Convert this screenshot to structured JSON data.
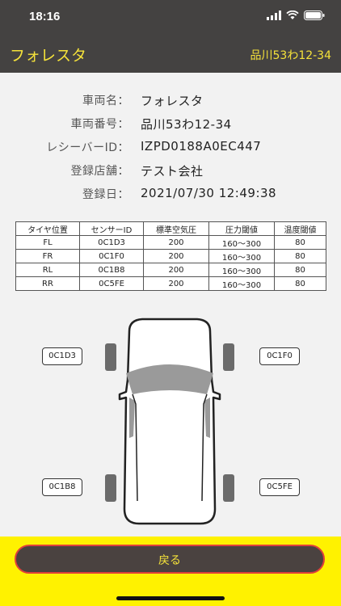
{
  "status": {
    "time": "18:16"
  },
  "header": {
    "title": "フォレスタ",
    "plate": "品川53わ12-34"
  },
  "info": [
    {
      "label": "車両名：",
      "value": "フォレスタ"
    },
    {
      "label": "車両番号：",
      "value": "品川53わ12-34"
    },
    {
      "label": "レシーバーID：",
      "value": "IZPD0188A0EC447"
    },
    {
      "label": "登録店舗：",
      "value": "テスト会社"
    },
    {
      "label": "登録日：",
      "value": "2021/07/30 12:49:38"
    }
  ],
  "table": {
    "headers": [
      "タイヤ位置",
      "センサーID",
      "標準空気圧",
      "圧力閾値",
      "温度閾値"
    ],
    "rows": [
      [
        "FL",
        "0C1D3",
        "200",
        "160～300",
        "80"
      ],
      [
        "FR",
        "0C1F0",
        "200",
        "160～300",
        "80"
      ],
      [
        "RL",
        "0C1B8",
        "200",
        "160～300",
        "80"
      ],
      [
        "RR",
        "0C5FE",
        "200",
        "160～300",
        "80"
      ]
    ]
  },
  "sensors": {
    "fl": "0C1D3",
    "fr": "0C1F0",
    "rl": "0C1B8",
    "rr": "0C5FE"
  },
  "footer": {
    "back_label": "戻る"
  },
  "colors": {
    "header_bg": "#444241",
    "accent_yellow": "#f5e23a",
    "footer_bg": "#fff200",
    "button_border": "#e0403a"
  }
}
